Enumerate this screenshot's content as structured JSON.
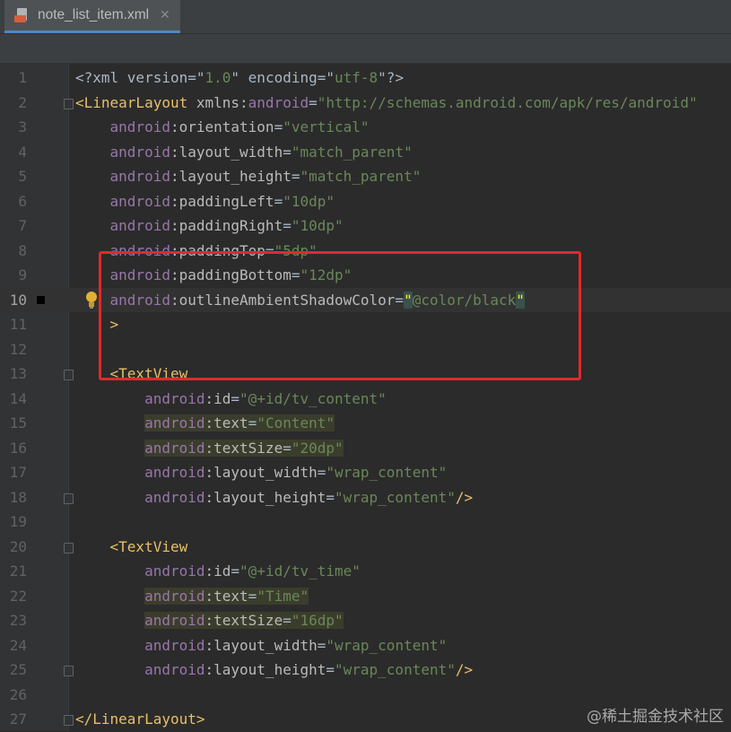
{
  "tab": {
    "filename": "note_list_item.xml",
    "icon": "xml-file-icon",
    "close": "✕"
  },
  "lines": [
    {
      "n": "1",
      "tokens": [
        [
          "t-xml",
          "<?xml version=\""
        ],
        [
          "t-val",
          "1.0"
        ],
        [
          "t-xml",
          "\" encoding=\""
        ],
        [
          "t-val",
          "utf-8"
        ],
        [
          "t-xml",
          "\"?>"
        ]
      ]
    },
    {
      "n": "2",
      "tokens": [
        [
          "t-tag",
          "<LinearLayout "
        ],
        [
          "t-attr",
          "xmlns:"
        ],
        [
          "t-ns",
          "android"
        ],
        [
          "t-punc",
          "="
        ],
        [
          "t-val",
          "\"http://schemas.android.com/apk/res/android\""
        ]
      ]
    },
    {
      "n": "3",
      "tokens": [
        [
          "t-punc",
          "    "
        ],
        [
          "t-ns",
          "android"
        ],
        [
          "t-attr",
          ":orientation"
        ],
        [
          "t-punc",
          "="
        ],
        [
          "t-val",
          "\"vertical\""
        ]
      ]
    },
    {
      "n": "4",
      "tokens": [
        [
          "t-punc",
          "    "
        ],
        [
          "t-ns",
          "android"
        ],
        [
          "t-attr",
          ":layout_width"
        ],
        [
          "t-punc",
          "="
        ],
        [
          "t-val",
          "\"match_parent\""
        ]
      ]
    },
    {
      "n": "5",
      "tokens": [
        [
          "t-punc",
          "    "
        ],
        [
          "t-ns",
          "android"
        ],
        [
          "t-attr",
          ":layout_height"
        ],
        [
          "t-punc",
          "="
        ],
        [
          "t-val",
          "\"match_parent\""
        ]
      ]
    },
    {
      "n": "6",
      "tokens": [
        [
          "t-punc",
          "    "
        ],
        [
          "t-ns",
          "android"
        ],
        [
          "t-attr",
          ":paddingLeft"
        ],
        [
          "t-punc",
          "="
        ],
        [
          "t-val",
          "\"10dp\""
        ]
      ]
    },
    {
      "n": "7",
      "tokens": [
        [
          "t-punc",
          "    "
        ],
        [
          "t-ns",
          "android"
        ],
        [
          "t-attr",
          ":paddingRight"
        ],
        [
          "t-punc",
          "="
        ],
        [
          "t-val",
          "\"10dp\""
        ]
      ]
    },
    {
      "n": "8",
      "tokens": [
        [
          "t-punc",
          "    "
        ],
        [
          "t-ns",
          "android"
        ],
        [
          "t-attr",
          ":paddingTop"
        ],
        [
          "t-punc",
          "="
        ],
        [
          "t-val",
          "\"5dp\""
        ]
      ]
    },
    {
      "n": "9",
      "tokens": [
        [
          "t-punc",
          "    "
        ],
        [
          "t-ns",
          "android"
        ],
        [
          "t-attr",
          ":paddingBottom"
        ],
        [
          "t-punc",
          "="
        ],
        [
          "t-val",
          "\"12dp\""
        ]
      ]
    },
    {
      "n": "10",
      "tokens": [
        [
          "t-punc",
          "    "
        ],
        [
          "t-ns",
          "android"
        ],
        [
          "t-attr",
          ":outlineAmbientShadowColor"
        ],
        [
          "t-punc",
          "="
        ],
        [
          "brace",
          "\""
        ],
        [
          "t-val",
          "@color/black"
        ],
        [
          "brace",
          "\""
        ]
      ]
    },
    {
      "n": "11",
      "tokens": [
        [
          "t-punc",
          "    "
        ],
        [
          "t-tag",
          ">"
        ]
      ]
    },
    {
      "n": "12",
      "tokens": []
    },
    {
      "n": "13",
      "tokens": [
        [
          "t-punc",
          "    "
        ],
        [
          "t-tag",
          "<TextView"
        ]
      ]
    },
    {
      "n": "14",
      "tokens": [
        [
          "t-punc",
          "        "
        ],
        [
          "t-ns",
          "android"
        ],
        [
          "t-attr",
          ":id"
        ],
        [
          "t-punc",
          "="
        ],
        [
          "t-val",
          "\"@+id/tv_content\""
        ]
      ]
    },
    {
      "n": "15",
      "tokens": [
        [
          "t-punc",
          "        "
        ],
        [
          "t-ns hl",
          "android"
        ],
        [
          "t-attr hl",
          ":text"
        ],
        [
          "t-punc hl",
          "="
        ],
        [
          "t-val hl",
          "\"Content\""
        ]
      ]
    },
    {
      "n": "16",
      "tokens": [
        [
          "t-punc",
          "        "
        ],
        [
          "t-ns hl",
          "android"
        ],
        [
          "t-attr hl",
          ":textSize"
        ],
        [
          "t-punc hl",
          "="
        ],
        [
          "t-val hl",
          "\"20dp\""
        ]
      ]
    },
    {
      "n": "17",
      "tokens": [
        [
          "t-punc",
          "        "
        ],
        [
          "t-ns",
          "android"
        ],
        [
          "t-attr",
          ":layout_width"
        ],
        [
          "t-punc",
          "="
        ],
        [
          "t-val",
          "\"wrap_content\""
        ]
      ]
    },
    {
      "n": "18",
      "tokens": [
        [
          "t-punc",
          "        "
        ],
        [
          "t-ns",
          "android"
        ],
        [
          "t-attr",
          ":layout_height"
        ],
        [
          "t-punc",
          "="
        ],
        [
          "t-val",
          "\"wrap_content\""
        ],
        [
          "t-tag",
          "/>"
        ]
      ]
    },
    {
      "n": "19",
      "tokens": []
    },
    {
      "n": "20",
      "tokens": [
        [
          "t-punc",
          "    "
        ],
        [
          "t-tag",
          "<TextView"
        ]
      ]
    },
    {
      "n": "21",
      "tokens": [
        [
          "t-punc",
          "        "
        ],
        [
          "t-ns",
          "android"
        ],
        [
          "t-attr",
          ":id"
        ],
        [
          "t-punc",
          "="
        ],
        [
          "t-val",
          "\"@+id/tv_time\""
        ]
      ]
    },
    {
      "n": "22",
      "tokens": [
        [
          "t-punc",
          "        "
        ],
        [
          "t-ns hl",
          "android"
        ],
        [
          "t-attr hl",
          ":text"
        ],
        [
          "t-punc hl",
          "="
        ],
        [
          "t-val hl",
          "\"Time\""
        ]
      ]
    },
    {
      "n": "23",
      "tokens": [
        [
          "t-punc",
          "        "
        ],
        [
          "t-ns hl",
          "android"
        ],
        [
          "t-attr hl",
          ":textSize"
        ],
        [
          "t-punc hl",
          "="
        ],
        [
          "t-val hl",
          "\"16dp\""
        ]
      ]
    },
    {
      "n": "24",
      "tokens": [
        [
          "t-punc",
          "        "
        ],
        [
          "t-ns",
          "android"
        ],
        [
          "t-attr",
          ":layout_width"
        ],
        [
          "t-punc",
          "="
        ],
        [
          "t-val",
          "\"wrap_content\""
        ]
      ]
    },
    {
      "n": "25",
      "tokens": [
        [
          "t-punc",
          "        "
        ],
        [
          "t-ns",
          "android"
        ],
        [
          "t-attr",
          ":layout_height"
        ],
        [
          "t-punc",
          "="
        ],
        [
          "t-val",
          "\"wrap_content\""
        ],
        [
          "t-tag",
          "/>"
        ]
      ]
    },
    {
      "n": "26",
      "tokens": []
    },
    {
      "n": "27",
      "tokens": [
        [
          "t-tag",
          "</LinearLayout>"
        ]
      ]
    }
  ],
  "current_line": "10",
  "fold_lines": [
    "2",
    "13",
    "18",
    "20",
    "25",
    "27"
  ],
  "watermark": "@稀土掘金技术社区"
}
